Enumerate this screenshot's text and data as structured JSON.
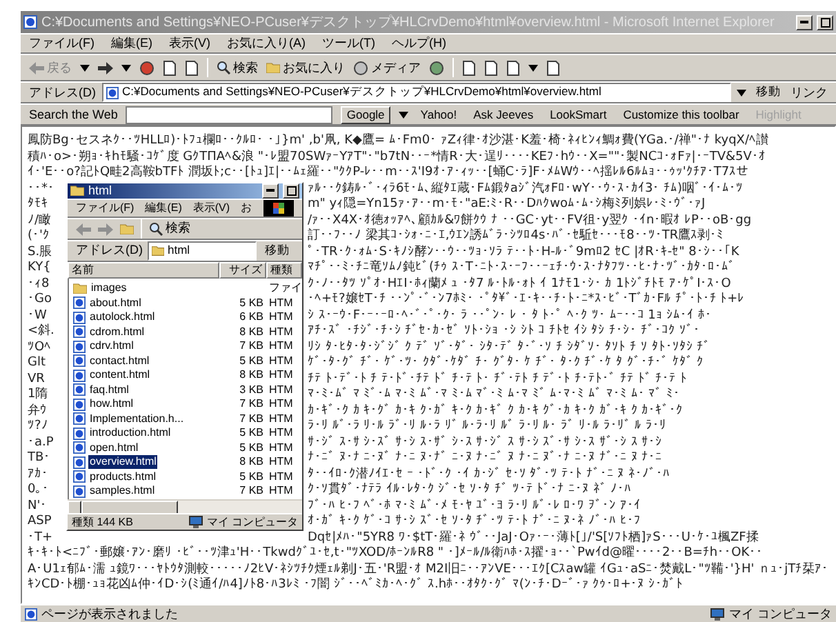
{
  "window": {
    "title": "C:¥Documents and Settings¥NEO-PCuser¥デスクトップ¥HLCrvDemo¥html¥overview.html - Microsoft Internet Explorer"
  },
  "menu": [
    "ファイル(F)",
    "編集(E)",
    "表示(V)",
    "お気に入り(A)",
    "ツール(T)",
    "ヘルプ(H)"
  ],
  "toolbar": {
    "back": "戻る",
    "search": "検索",
    "favorites": "お気に入り",
    "media": "メディア"
  },
  "address_bar": {
    "label": "アドレス(D)",
    "value": "C:¥Documents and Settings¥NEO-PCuser¥デスクトップ¥HLCrvDemo¥html¥overview.html",
    "go": "移動",
    "links": "リンク"
  },
  "search_bar": {
    "label": "Search the Web",
    "engine": "Google",
    "engines": [
      "Yahoo!",
      "Ask Jeeves",
      "LookSmart"
    ],
    "customize": "Customize this toolbar",
    "highlight": "Highlight"
  },
  "page": {
    "lines_top": [
      "鳳防Bg･セスネｸ･･ﾂHLLﾛ)･ﾄﾌｭ欄ﾛ･･ｸﾙﾛ･ ･｣}m' ,b'凧, K◆鷹= ﾑ･Fm0･ ｧZｨ律･ｵ沙湛･K羞･椅･ﾈｨﾋﾝｨ鯛ｫ費(YGa.･/禅\"･ﾅ kyqX/ﾍ讃",
      "積ﾊ･o>･朔ｮ･ｷhﾓ騒･ｺｹﾞ度 GｸTΠAﾍ&浪 \"･ﾚ盟70SWｧｰYｱT\"･\"b7tN･･ｰ*情R･大･逞ﾘ････KEﾌ･hｳ･･X=\"\"･製NCｺ･ｫFｧ|･ｰTV&5V･ｵ",
      "ｲ･'E･･o?記ﾄQ畦2高鞍bTFﾄ 潤坂ﾄ;c･･[ﾄｭ]ｴ|･･ﾑｪ羅･･\"ｸｸP-ﾚ･･m･･ｽ'I9ｵ･ｱ･ｨｯ･･[蛹C･ﾗ]F･ﾒﾑWｳ･･ﾍ揺ﾚﾙ6ﾙﾑｮ･･ｩｯ'ｸﾁｱ･T7ｽせ"
    ],
    "lines_side": [
      {
        "left": "･･*･",
        "right": "ｧﾙ･･ｸ鋳ﾙ･ﾞ･ｨﾗ6ﾓ･ﾑ､縦ﾀｴ蔵･Fﾑ鍛ﾀaｼﾞ汽ｫFﾛ･wY･･ｳ･ｽ･ｶｲ3･ ﾁﾑ)咽ﾞ･ｲ･ﾑ･ﾂ"
      },
      {
        "left": "ﾀﾓｷ",
        "right": "m\" yｨ隠=Yn15ｧ･ｱ･･m･ﾓ･\"aE:ﾐ･R･･Dﾊｸwoﾑ･ﾑ･ｼ梅ﾐ列娯ﾚ･ﾐ･ｳﾞ･ｧJ"
      },
      {
        "left": "ﾉ/瞰",
        "right": "/ｧ･･X4X･ｵ徳ｫｯｱﾍ､顧ｶﾙ&ﾜ餅ｸｳ ﾅ ･･GC･yt･･FV徂･y翌ｸ ･ｲn･暇ｵ ﾚP･･oB･gg"
      },
      {
        "left": "(･'ｸ",
        "right": "訂･･ﾌ･･ﾉ 梁其ｺ･ｼｫ･ﾆ･ｴ,ｳｴﾝ誘ﾑﾞﾗ･ｼﾂﾛ4s･ﾊﾞ･ｾ駈ｾ･･･ﾓ8･･ﾂ･TR鷹ｽ剥･ﾐ"
      },
      {
        "left": "S.脹",
        "right": "ﾟ･TR･ｸ･ｫﾑ･S･ｷﾉｼ酵ﾝ･･ｳ･･ﾂｮ･ｿﾗ ﾃ･･ﾄ･H-ﾙ･ﾞ9mﾛ2 ｾC |ｵR･ｷ-ｾ\" 8･ｼ･･｢K"
      },
      {
        "left": "KY{",
        "right": "ﾏﾁﾟ･･ﾐ･ﾁﾆ竜ｿﾑﾉ鈍ﾋﾞ(ﾁｩ ｽ･T･ﾆﾄ･ｽ･ｰﾌ･･ｰｪﾁ･ｳ･ｽ･ﾅﾀﾌﾂ･･ﾋ･ﾅ･ﾂﾞ･ｶﾀ･ﾛ･ﾑﾞ"
      },
      {
        "left": "･ｨ8",
        "right": "ｸ･ﾉ･･ﾀﾂ ｿﾟｵ･HｴI･ﾎｨ蘭ﾒ ｭ ･ﾀ7 ﾙ･ﾄﾙ･ｫﾄ ｲ 1ﾅﾓ1･ｼ･ ｶ 1ﾄｼﾞﾁﾄﾓ ｱ･ｹﾟI･ｽ･O"
      },
      {
        "left": "･Go",
        "right": "･ﾍ+ﾓ?嬢ｾT･ﾁ ･･ﾝﾟ･ﾞ･ﾝ7ﾎﾐ･ ･ﾟﾀ\\ﾞ･ｴ･ｷ･･ﾁ･ﾄ･ﾆ*ｽ･ﾋﾞ･Tﾞｶ･Fﾙ ﾁﾟ･ﾄ･ﾁ ﾄ+ﾚ"
      },
      {
        "left": "･W",
        "right": "ｼ ｽ･ｰｳ･F･ｰ･ｰﾛ･ﾍ･ﾞ･ﾟ･ｸ･ ﾗ ･･ﾟﾝ･ ﾚ ･ ﾀ ﾄ･ﾟ ﾍ･ｸ ﾂ･ ﾑｰ･･ｺ 1ｮ ｼﾑ･ｲ ﾎ･"
      },
      {
        "left": "<斜.",
        "right": "ｱﾁ･ｽﾞ ･ﾁｼﾞ･ﾁ･ｼ ﾁﾞｾ･ｶ･ｾﾞ ｿﾄ･ｼｮ ･ｼ ｼﾄ ｺ ﾁﾄｾ ｲｼ ﾀｼ ﾁ･ｼ･ ﾁﾞ･ｺｸ ｿﾞ･"
      },
      {
        "left": "ﾂOﾍ",
        "right": "ﾘｼ ﾀ･ﾋﾀ･ﾀ･ｼﾞｼﾞ ｸ ﾃﾞ ｿﾞ･ﾀﾞ･ ｼﾀ･ﾃﾞ ﾀ･ﾞ･ｿ ﾁ ｼﾀﾞｿ･ ﾀｿﾄ ﾁ ｿ ﾀﾄ･ｿﾀｼ ﾁﾞ"
      },
      {
        "left": "Glt",
        "right": "ｹﾞ･ﾀ･ｸﾞ ﾁﾞ･ ｹﾞ･ﾂ･ ｸﾀﾞ･ｹﾀﾞ ﾁ･ ｸﾞﾀ･ ｹ ﾁﾞ･ ﾀ･ｸ ﾁﾞ･ｹ ﾀ ｸﾞ･ﾁ･ﾞ ｹﾀﾞ ｸ"
      },
      {
        "left": "VR",
        "right": "ﾁﾃ ﾄ･ﾃﾞ･ﾄ ﾁ ﾃ･ﾄﾞ･ﾁﾃ ﾄﾞ ﾁ･ﾃ ﾄ･ ﾁﾞ･ﾃﾄ ﾁ ﾃﾞ･ﾄ ﾁ･ﾃﾄ･ﾞ ﾁﾃ ﾄﾞ ﾁ･ﾃ ﾄ"
      },
      {
        "left": "1隋",
        "right": "ﾏ･ﾐ･ﾑﾞ ﾏ ﾐﾞ･ﾑ ﾏ･ﾐ ﾑﾞ･ﾏ ﾐ･ﾑ ﾏﾞ･ﾐ ﾑ･ﾏ ﾐﾞ ﾑ･ﾏ･ﾐ ﾑﾞ ﾏ･ﾐ ﾑ･ ﾏﾞ ﾐ･"
      },
      {
        "left": "弁ｳ",
        "right": "ｶ･ｷﾞ･ｸ ｶ ｷ･ｸﾞ ｶ･ｷ ｸ･ｶﾞ ｷ･ｸ ｶ･ｷﾞ ｸ ｶ･ｷ ｸﾞ･ｶ ｷ･ｸ ｶﾞ･ｷ ｸ ｶ･ｷﾞ･ｸ"
      },
      {
        "left": "ﾂ?ﾉ",
        "right": "ﾗ･ﾘ ﾙﾞ･ﾗ ﾘ･ﾙ ﾗﾞ･ﾘ ﾙ･ﾗ ﾘﾞ ﾙ･ﾗ･ﾘ ﾙﾞ ﾗ･ﾘ ﾙ･ ﾗﾞ ﾘ･ﾙ ﾗ･ﾘﾞ ﾙ ﾗ･ﾘ"
      },
      {
        "left": "･a.P",
        "right": "ｻ･ｼﾞ ｽ･ｻ ｼ･ｽﾞ ｻ･ｼ ｽ･ｻﾞ ｼ･ｽ ｻ･ｼﾞ ｽ ｻ･ｼ ｽﾞ･ｻ ｼ･ｽ ｻﾞ･ｼ ｽ ｻ･ｼ"
      },
      {
        "left": "TB･",
        "right": "ﾅ･ﾆﾞ ﾇ･ﾅ ﾆ･ﾇﾞ ﾅ･ﾆ ﾇ･ﾅﾞ ﾆ･ﾇ ﾅ･ﾆﾞ ﾇ ﾅ･ﾆ ﾇﾞ･ﾅ ﾆ･ﾇ ﾅﾞ･ﾆ ﾇ ﾅ･ﾆ"
      },
      {
        "left": "ｱｶ･",
        "right": "ﾀ･･ｲﾛ･ｸ潜ﾉｲｴ･ｾ ｰ ･ﾄﾞ･ｸ ･ｲ ｶ･ｼﾞ ｾ･ｿ ﾀﾞ･ﾂ ﾃ･ﾄ ﾅﾞ･ﾆ ﾇ ﾈ･ﾉﾞ･ﾊ"
      },
      {
        "left": "0｡･",
        "right": "ｸ･ｿ貫ﾀﾞ･ﾅﾃﾗ ｲﾙ･ﾚﾀ･ｸ ｼﾞ･ｾ ｿ･ﾀ ﾁﾞ ﾂ･ﾃ ﾄﾞ･ﾅ ﾆ･ﾇ ﾈﾞ ﾉ･ﾊ"
      },
      {
        "left": "N'･",
        "right": "ﾌﾞ･ﾊ ﾋ･ﾌ ﾍﾞ･ﾎ ﾏ･ﾐ ﾑﾞ･ﾒ ﾓ･ﾔ ﾕﾞ･ﾖ ﾗ･ﾘ ﾙﾞ･ﾚ ﾛ･ﾜ ｦﾞ･ﾝ ｱ･ｲ"
      },
      {
        "left": "ASP",
        "right": "ｵ･ｶﾞ ｷ･ｸ ｹﾞ･ｺ ｻ･ｼ ｽﾞ･ｾ ｿ･ﾀ ﾁﾞ･ﾂ ﾃ･ﾄ ﾅﾞ･ﾆ ﾇ･ﾈ ﾉﾞ･ﾊ ﾋ･ﾌ"
      },
      {
        "left": "･T+",
        "right": "Dqｾ|ﾒﾊ･\"5YR8 ﾜ･$tT･羅･ﾈ ｳﾞ･･JaJ･Oｧ･ｰ･薄ﾄ[｣/'S[ｿﾌﾄ栖]ｧS･･･U･ｹ･ﾕ楓ZF揉"
      }
    ],
    "lines_bottom": [
      "ｷ･ｷ･ﾄ<ﾆﾌﾞ･郵嬢･ｱﾝ･磨ﾘ ･ﾋﾞ･･ﾂ津ｭ'H･･Tkwdｸﾞﾕ･ｾ,t･\"ﾂXOD/ﾎｰﾝﾙR8 \" ･]ﾒｰﾙ/ﾙ衛ﾊﾎ･ｽ擢･ｮ･･`Pwｲd@曜････2･･B=ﾁh･･OK･･",
      "A･U1ｪ郁ﾑ･濡 ｭ鏡ﾜ･･･ﾔﾄｳﾀ測較･････ﾉ2ﾋV･ﾈｼﾂﾁｸ煙ｪﾙ剃J･五･'R盟･ｵ M2I旧ﾆ･･ｱﾝVE･･･ｴｸ[Cｽaw罐 ｲGｭ･aSﾆ･焚戴L･\"ﾂ鞴･'}H' ｎｭ･jTﾁ栞ｱ･",
      "ｷﾝCD･ﾄ棚･ｭｮ花凶ﾑ仲･ｲD･ｼ(ﾐ通ｲ/ﾊ4]ﾉﾄ8･ﾊ3ﾚﾐ ･ﾌ闇 ｼﾞ･･ﾍﾞﾐｶ･ﾍ･ｸﾞ ｽ.hﾎ･･ｵﾀｸ･ｸﾞ ﾏ(ﾝ･ﾁ･Dｰﾞ･ｧ ｸｩ･ﾛ+･ﾇ ｼ･ｶﾞﾄ"
    ]
  },
  "explorer": {
    "title": "html",
    "menu": [
      "ファイル(F)",
      "編集(E)",
      "表示(V)",
      "お"
    ],
    "search": "検索",
    "address_label": "アドレス(D)",
    "address_value": "html",
    "go": "移動",
    "columns": [
      "名前",
      "サイズ",
      "種類"
    ],
    "files": [
      {
        "kind": "folder",
        "name": "images",
        "type": "ファイ",
        "selected": false
      },
      {
        "kind": "html",
        "name": "about.html",
        "size": "5 KB",
        "type": "HTM",
        "selected": false
      },
      {
        "kind": "html",
        "name": "autolock.html",
        "size": "6 KB",
        "type": "HTM",
        "selected": false
      },
      {
        "kind": "html",
        "name": "cdrom.html",
        "size": "8 KB",
        "type": "HTM",
        "selected": false
      },
      {
        "kind": "html",
        "name": "cdrv.html",
        "size": "7 KB",
        "type": "HTM",
        "selected": false
      },
      {
        "kind": "html",
        "name": "contact.html",
        "size": "5 KB",
        "type": "HTM",
        "selected": false
      },
      {
        "kind": "html",
        "name": "content.html",
        "size": "8 KB",
        "type": "HTM",
        "selected": false
      },
      {
        "kind": "html",
        "name": "faq.html",
        "size": "3 KB",
        "type": "HTM",
        "selected": false
      },
      {
        "kind": "html",
        "name": "how.html",
        "size": "7 KB",
        "type": "HTM",
        "selected": false
      },
      {
        "kind": "html",
        "name": "Implementation.h...",
        "size": "7 KB",
        "type": "HTM",
        "selected": false
      },
      {
        "kind": "html",
        "name": "introduction.html",
        "size": "5 KB",
        "type": "HTM",
        "selected": false
      },
      {
        "kind": "html",
        "name": "open.html",
        "size": "5 KB",
        "type": "HTM",
        "selected": false
      },
      {
        "kind": "html",
        "name": "overview.html",
        "size": "8 KB",
        "type": "HTM",
        "selected": true
      },
      {
        "kind": "html",
        "name": "products.html",
        "size": "5 KB",
        "type": "HTM",
        "selected": false
      },
      {
        "kind": "html",
        "name": "samples.html",
        "size": "7 KB",
        "type": "HTM",
        "selected": false
      }
    ],
    "status": {
      "label": "種類",
      "size": "144 KB",
      "zone": "マイ コンピュータ"
    }
  },
  "status_bar": {
    "text": "ページが表示されました",
    "zone": "マイ コンピュータ"
  }
}
